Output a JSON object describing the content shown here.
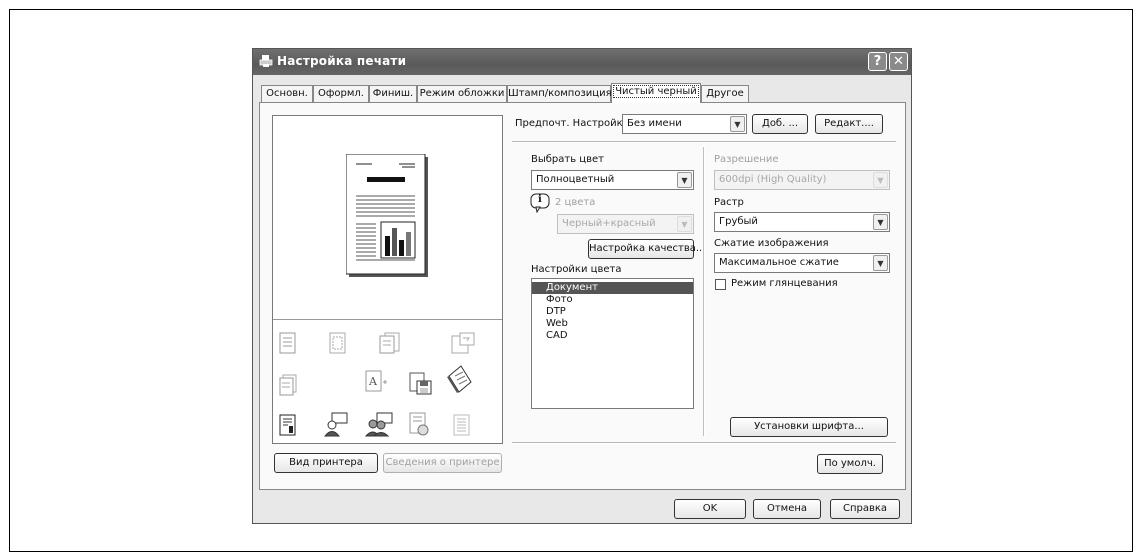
{
  "window": {
    "title": "Настройка печати",
    "help_btn": "?",
    "close_btn": "✕"
  },
  "tabs": [
    "Основн.",
    "Оформл.",
    "Финиш.",
    "Режим обложки",
    "Штамп/композиция",
    "Чистый черный",
    "Другое"
  ],
  "favorites": {
    "label": "Предпочт. Настройки",
    "value": "Без имени",
    "add_btn": "Доб. ...",
    "edit_btn": "Редакт...."
  },
  "color": {
    "select_label": "Выбрать цвет",
    "select_value": "Полноцветный",
    "info_glyph": "i",
    "two_color_label": "2 цвета",
    "two_color_value": "Черный+красный",
    "quality_btn": "Настройка качества...",
    "settings_label": "Настройки цвета",
    "settings_items": [
      "Документ",
      "Фото",
      "DTP",
      "Web",
      "CAD"
    ],
    "selected_item": "Документ"
  },
  "right": {
    "resolution_label": "Разрешение",
    "resolution_value": "600dpi (High Quality)",
    "screen_label": "Растр",
    "screen_value": "Грубый",
    "compression_label": "Сжатие изображения",
    "compression_value": "Максимальное сжатие",
    "glossy_label": "Режим глянцевания",
    "font_btn": "Установки шрифта...",
    "default_btn": "По умолч."
  },
  "preview": {
    "printer_view_btn": "Вид принтера",
    "printer_info_btn": "Сведения о принтере"
  },
  "footer": {
    "ok": "OK",
    "cancel": "Отмена",
    "help": "Справка"
  }
}
